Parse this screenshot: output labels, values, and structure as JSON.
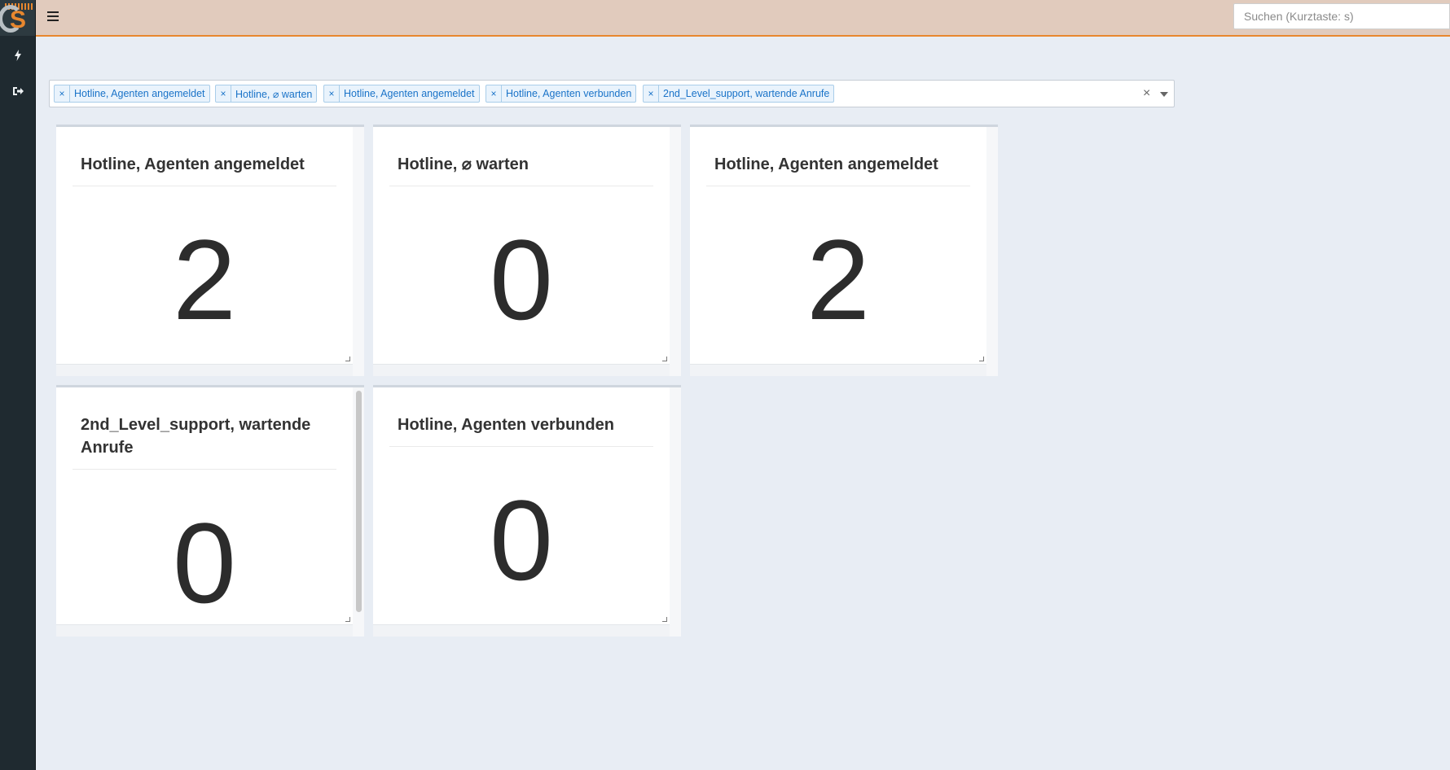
{
  "search": {
    "placeholder": "Suchen (Kurztaste: s)"
  },
  "filter": {
    "tags": [
      "Hotline, Agenten angemeldet",
      "Hotline, ⌀ warten",
      "Hotline, Agenten angemeldet",
      "Hotline, Agenten verbunden",
      "2nd_Level_support, wartende Anrufe"
    ],
    "remove_symbol": "×",
    "clear_symbol": "×"
  },
  "widgets": [
    {
      "title": "Hotline, Agenten angemeldet",
      "value": "2"
    },
    {
      "title": "Hotline, ⌀ warten",
      "value": "0"
    },
    {
      "title": "Hotline, Agenten angemeldet",
      "value": "2"
    },
    {
      "title": "2nd_Level_support, wartende Anrufe",
      "value": "0"
    },
    {
      "title": "Hotline, Agenten verbunden",
      "value": "0"
    }
  ],
  "colors": {
    "accent": "#e8872e",
    "sidebar": "#1f2a30",
    "topbar": "#e1cbbd",
    "tag_text": "#1a73c8"
  },
  "icons": {
    "menu": "hamburger-icon",
    "flash": "lightning-icon",
    "logout": "logout-icon",
    "logo": "app-logo"
  }
}
